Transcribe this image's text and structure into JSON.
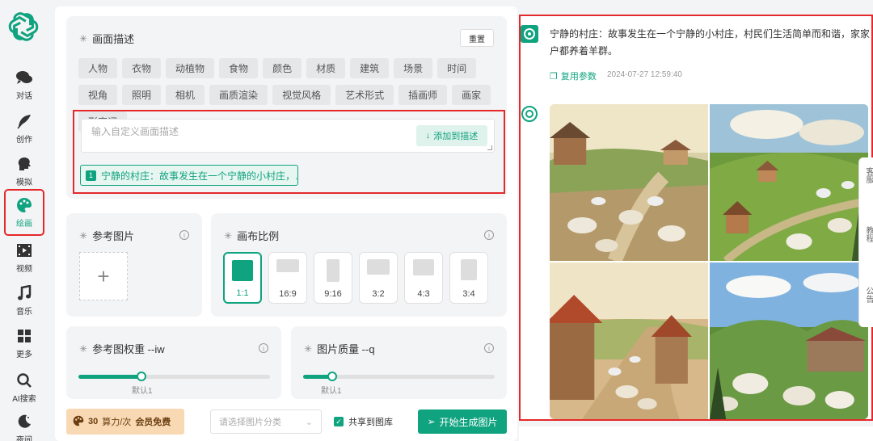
{
  "nav": {
    "items": [
      {
        "label": "对话",
        "icon": "chat-icon"
      },
      {
        "label": "创作",
        "icon": "feather-icon"
      },
      {
        "label": "模拟",
        "icon": "head-icon"
      },
      {
        "label": "绘画",
        "icon": "palette-icon",
        "active": true
      },
      {
        "label": "视频",
        "icon": "film-icon"
      },
      {
        "label": "音乐",
        "icon": "music-icon"
      },
      {
        "label": "更多",
        "icon": "grid-icon"
      },
      {
        "label": "AI搜索",
        "icon": "search-icon"
      },
      {
        "label": "夜间",
        "icon": "moon-icon"
      }
    ]
  },
  "description": {
    "title": "画面描述",
    "reset_label": "重置",
    "tags": [
      "人物",
      "衣物",
      "动植物",
      "食物",
      "颜色",
      "材质",
      "建筑",
      "场景",
      "时间",
      "视角",
      "照明",
      "相机",
      "画质渲染",
      "视觉风格",
      "艺术形式",
      "插画师",
      "画家",
      "形容词"
    ],
    "input_placeholder": "输入自定义画面描述",
    "add_button_label": "添加到描述",
    "chip_index": "1",
    "chip_text": "宁静的村庄：故事发生在一个宁静的小村庄，..."
  },
  "reference": {
    "title": "参考图片",
    "plus": "+"
  },
  "aspect": {
    "title": "画布比例",
    "options": [
      {
        "label": "1:1",
        "active": true
      },
      {
        "label": "16:9"
      },
      {
        "label": "9:16"
      },
      {
        "label": "3:2"
      },
      {
        "label": "4:3"
      },
      {
        "label": "3:4"
      }
    ]
  },
  "iw": {
    "title": "参考图权重 --iw",
    "default_label": "默认1",
    "value_fraction": 0.33
  },
  "quality": {
    "title": "图片质量 --q",
    "default_label": "默认1",
    "value_fraction": 0.15
  },
  "footer": {
    "price_value": "30",
    "price_unit": "算力/次",
    "price_member": "会员免费",
    "category_placeholder": "请选择图片分类",
    "share_label": "共享到图库",
    "share_checked": true,
    "generate_label": "开始生成图片"
  },
  "chat": {
    "message_line1": "宁静的村庄：故事发生在一个宁静的小村庄，村民们生活简单而和谐，家家",
    "message_line2": "户都养着羊群。",
    "reuse_label": "复用参数",
    "timestamp": "2024-07-27 12:59:40"
  },
  "side_tabs": [
    "客服",
    "教程",
    "公告"
  ],
  "colors": {
    "accent": "#10a37f",
    "highlight": "#e5282b"
  }
}
